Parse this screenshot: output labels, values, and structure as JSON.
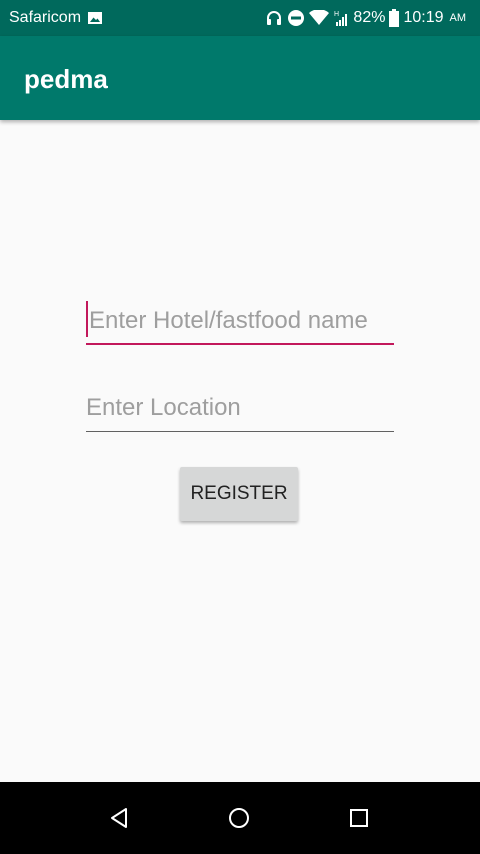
{
  "status_bar": {
    "carrier": "Safaricom",
    "battery": "82%",
    "time": "10:19",
    "ampm": "AM",
    "icons": [
      "image-icon",
      "headphones-icon",
      "do-not-disturb-icon",
      "wifi-icon",
      "signal-icon",
      "battery-icon"
    ]
  },
  "app_bar": {
    "title": "pedma"
  },
  "form": {
    "name_placeholder": "Enter Hotel/fastfood name",
    "location_placeholder": "Enter Location",
    "register_label": "REGISTER"
  },
  "colors": {
    "primary": "#00796b",
    "primary_dark": "#00695c",
    "accent": "#c2185b"
  },
  "nav_bar": {
    "icons": [
      "back-icon",
      "home-icon",
      "recents-icon"
    ]
  }
}
